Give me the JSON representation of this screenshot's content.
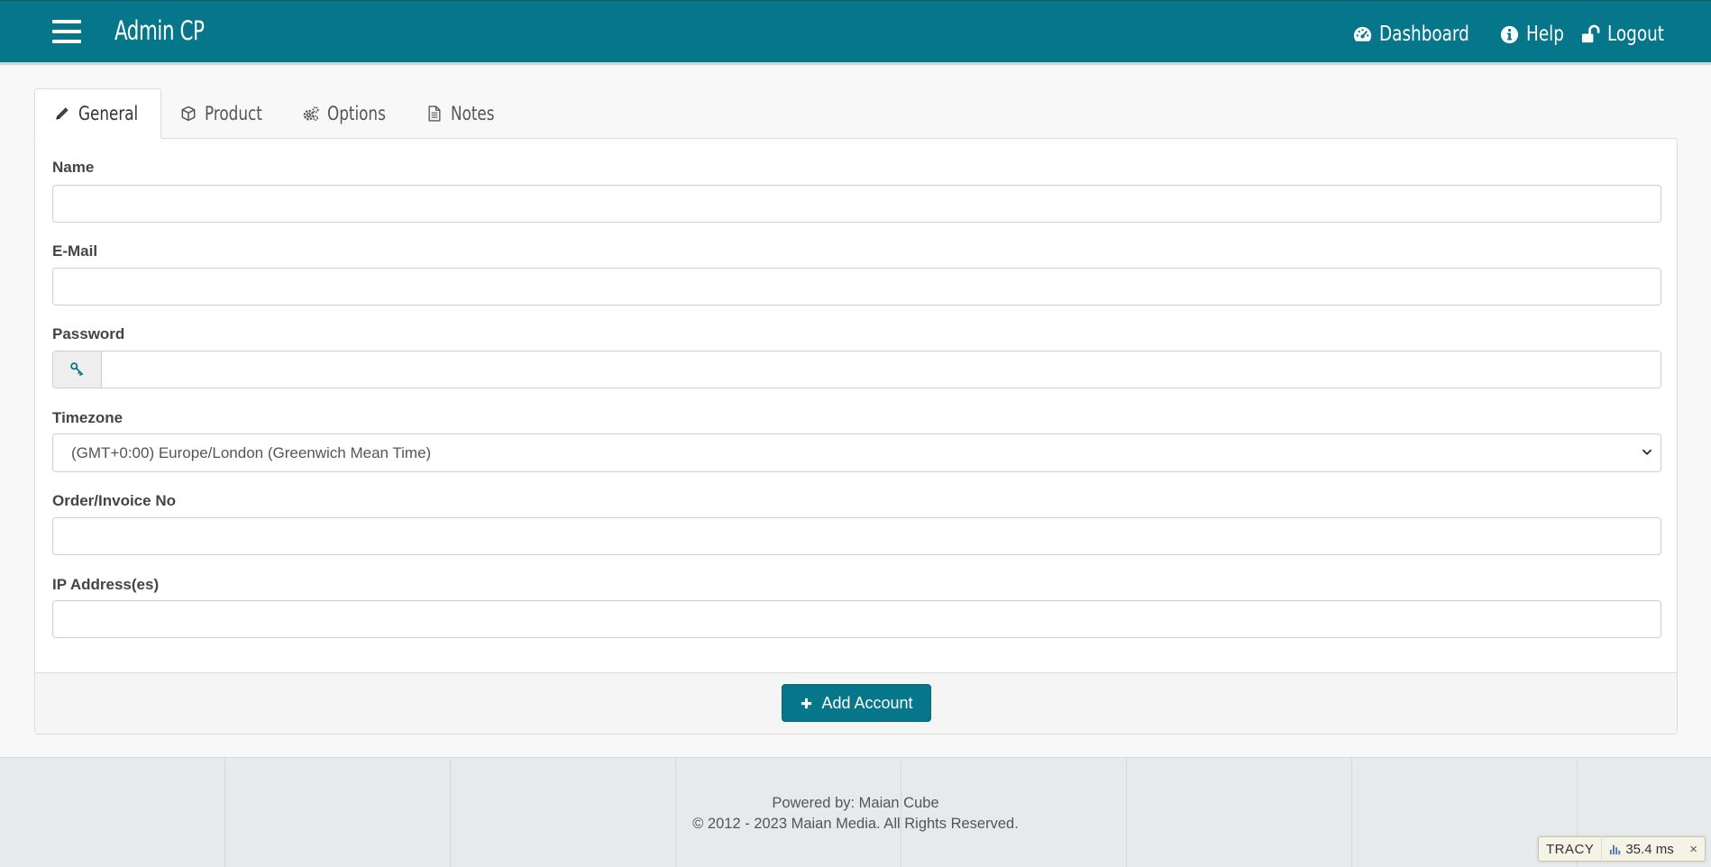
{
  "header": {
    "brand": "Admin CP",
    "nav": [
      {
        "label": "Dashboard",
        "icon": "dashboard-icon"
      },
      {
        "label": "Help",
        "icon": "info-icon"
      },
      {
        "label": "Logout",
        "icon": "unlock-icon"
      }
    ]
  },
  "tabs": [
    {
      "label": "General",
      "icon": "pencil-icon",
      "active": true
    },
    {
      "label": "Product",
      "icon": "cube-icon",
      "active": false
    },
    {
      "label": "Options",
      "icon": "cogs-icon",
      "active": false
    },
    {
      "label": "Notes",
      "icon": "document-icon",
      "active": false
    }
  ],
  "form": {
    "name_label": "Name",
    "name_value": "",
    "email_label": "E-Mail",
    "email_value": "",
    "password_label": "Password",
    "password_value": "",
    "password_addon_icon": "key-icon",
    "timezone_label": "Timezone",
    "timezone_value": "(GMT+0:00) Europe/London (Greenwich Mean Time)",
    "order_label": "Order/Invoice No",
    "order_value": "",
    "ip_label": "IP Address(es)",
    "ip_value": ""
  },
  "actions": {
    "add_account_label": "Add Account",
    "add_icon": "plus-icon"
  },
  "footer": {
    "powered_by": "Powered by: Maian Cube",
    "copyright": "© 2012 - 2023 Maian Media. All Rights Reserved."
  },
  "tracy": {
    "label": "TRACY",
    "timing": "35.4 ms",
    "close": "×"
  },
  "colors": {
    "accent": "#06768a",
    "background": "#f8f8f8",
    "footer_bg": "#e7eaeb"
  }
}
